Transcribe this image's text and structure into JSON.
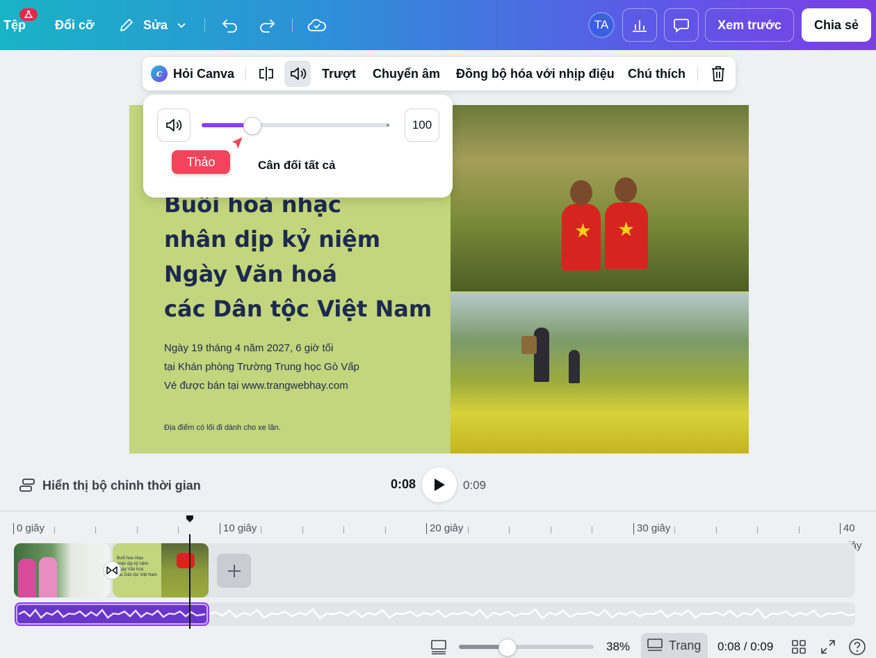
{
  "topbar": {
    "file": "Tệp",
    "resize": "Đổi cỡ",
    "edit": "Sửa",
    "avatar": "TA",
    "preview": "Xem trước",
    "share": "Chia sẻ"
  },
  "context_toolbar": {
    "ask_canva": "Hỏi Canva",
    "slide": "Trượt",
    "transition": "Chuyển âm",
    "sync_beat": "Đồng bộ hóa với nhịp điệu",
    "caption": "Chú thích"
  },
  "volume_popover": {
    "value": "100",
    "level_fraction": 0.27,
    "cursor_label": "Thảo",
    "balance_all": "Cân đối tất cả"
  },
  "design": {
    "title_lines": [
      "Buổi hoà nhạc",
      "nhân dịp kỷ niệm",
      "Ngày Văn hoá",
      "các Dân tộc Việt Nam"
    ],
    "info_lines": [
      "Ngày 19 tháng 4 năm 2027, 6 giờ tối",
      "tại Khán phòng Trường Trung học Gò Vấp",
      "Vé được bán tại www.trangwebhay.com"
    ],
    "footnote": "Địa điểm có lối đi dành cho xe lăn."
  },
  "playback": {
    "timeline_toggle": "Hiển thị bộ chỉnh thời gian",
    "current": "0:08",
    "total": "0:09"
  },
  "ruler": {
    "labels": [
      "0 giây",
      "10 giây",
      "20 giây",
      "30 giây",
      "40",
      "giây"
    ]
  },
  "clip2_text": [
    "Buổi hòa nhạc",
    "nhân dịp kỷ niệm",
    "Ngày Văn hoá",
    "các Dân tộc Việt Nam"
  ],
  "footer": {
    "zoom": "38%",
    "zoom_fraction": 0.36,
    "page": "Trang",
    "time": "0:08 / 0:09"
  },
  "colors": {
    "accent": "#8b3dff",
    "design_bg": "#c3d57d",
    "title_text": "#1d2a4d",
    "cursor_tag": "#f0455a"
  }
}
